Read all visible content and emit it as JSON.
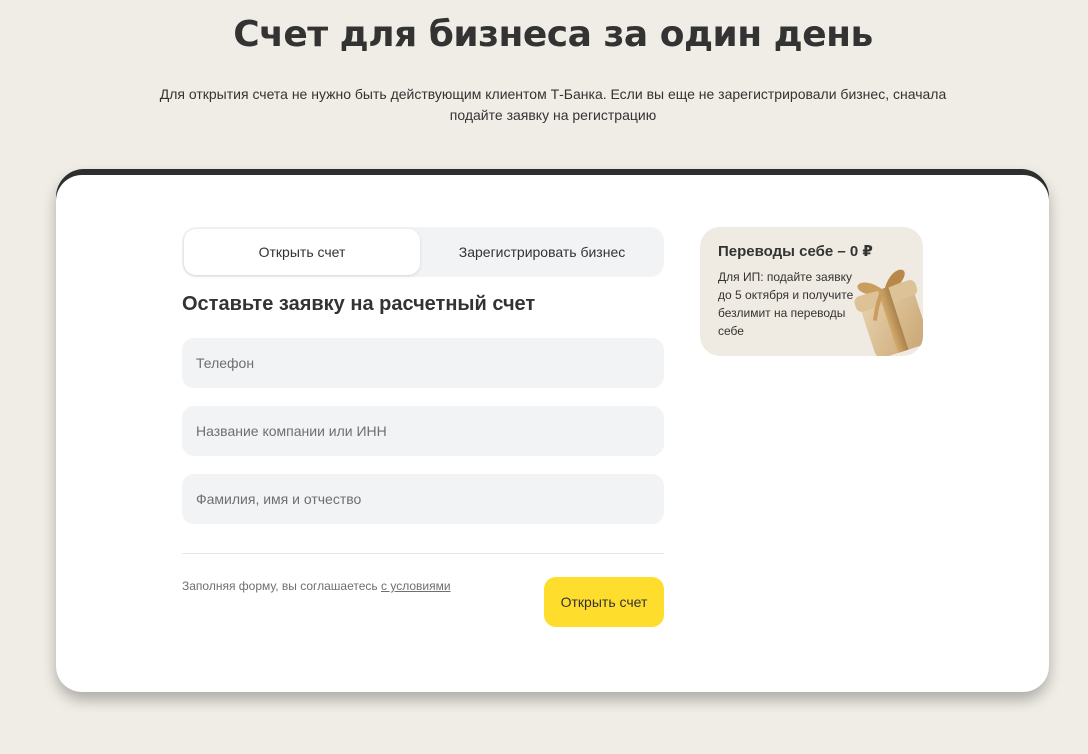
{
  "header": {
    "title": "Счет для бизнеса за один день",
    "subtitle": "Для открытия счета не нужно быть действующим клиентом Т-Банка. Если вы еще не зарегистрировали бизнес, сначала подайте заявку на регистрацию"
  },
  "tabs": [
    {
      "label": "Открыть счет",
      "active": true
    },
    {
      "label": "Зарегистрировать бизнес",
      "active": false
    }
  ],
  "form": {
    "title": "Оставьте заявку на расчетный счет",
    "fields": [
      {
        "placeholder": "Телефон",
        "value": ""
      },
      {
        "placeholder": "Название компании или ИНН",
        "value": ""
      },
      {
        "placeholder": "Фамилия, имя и отчество",
        "value": ""
      }
    ],
    "terms_text": "Заполняя форму, вы соглашаетесь ",
    "terms_link": "с условиями",
    "submit_label": "Открыть счет"
  },
  "promo": {
    "title": "Переводы себе – 0 ₽",
    "text": "Для ИП: подайте заявку до 5 октября и получите безлимит на переводы себе",
    "image_icon": "gift-box-icon"
  },
  "colors": {
    "page_background": "#f0ede6",
    "accent_yellow": "#ffdd2d",
    "field_background": "#f2f3f5",
    "promo_background": "#efebe2",
    "text_primary": "#333333"
  }
}
